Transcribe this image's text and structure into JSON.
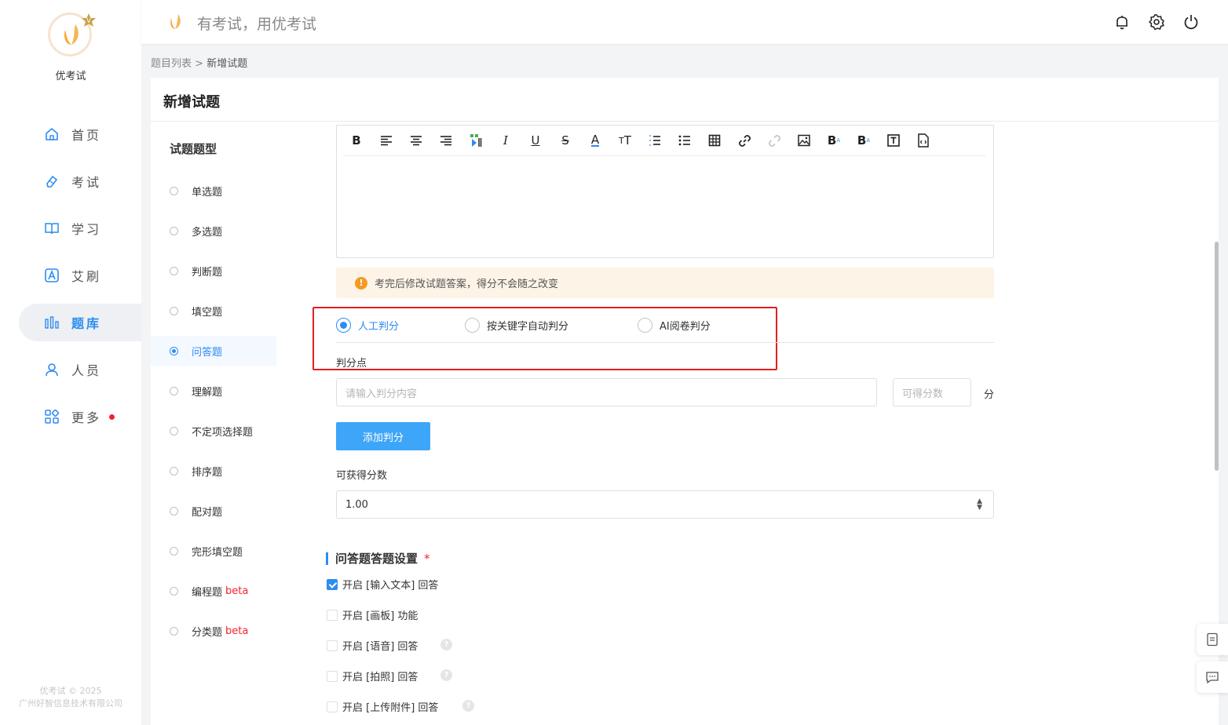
{
  "app": {
    "name": "优考试",
    "slogan": "有考试，用优考试",
    "copyright_line1": "优考试 © 2025",
    "copyright_line2": "广州好智信息技术有限公司"
  },
  "nav": [
    {
      "label": "首页",
      "icon": "home-icon"
    },
    {
      "label": "考试",
      "icon": "eraser-icon"
    },
    {
      "label": "学习",
      "icon": "book-icon"
    },
    {
      "label": "艾刷",
      "icon": "a-box-icon"
    },
    {
      "label": "题库",
      "icon": "bar-chart-icon",
      "active": true
    },
    {
      "label": "人员",
      "icon": "user-icon"
    },
    {
      "label": "更多",
      "icon": "apps-icon",
      "badge": "red-dot"
    }
  ],
  "header_icons": [
    "bell-icon",
    "gear-icon",
    "power-icon"
  ],
  "breadcrumb": {
    "parent": "题目列表",
    "separator": " > ",
    "current": "新增试题"
  },
  "page_title": "新增试题",
  "question_types": {
    "heading": "试题题型",
    "items": [
      {
        "label": "单选题"
      },
      {
        "label": "多选题"
      },
      {
        "label": "判断题"
      },
      {
        "label": "填空题"
      },
      {
        "label": "问答题",
        "selected": true
      },
      {
        "label": "理解题"
      },
      {
        "label": "不定项选择题"
      },
      {
        "label": "排序题"
      },
      {
        "label": "配对题"
      },
      {
        "label": "完形填空题"
      },
      {
        "label": "编程题",
        "beta": "beta"
      },
      {
        "label": "分类题",
        "beta": "beta"
      }
    ]
  },
  "editor_toolbar": [
    "bold-icon",
    "align-left-icon",
    "align-center-icon",
    "align-right-icon",
    "format-painter-icon",
    "italic-icon",
    "underline-icon",
    "strikethrough-icon",
    "font-color-icon",
    "font-size-icon",
    "ordered-list-icon",
    "unordered-list-icon",
    "table-icon",
    "link-icon",
    "unlink-icon",
    "image-icon",
    "superscript-icon",
    "subscript-icon",
    "textbox-icon",
    "source-code-icon"
  ],
  "warning": "考完后修改试题答案，得分不会随之改变",
  "scoring_mode": {
    "options": [
      {
        "label": "人工判分",
        "selected": true
      },
      {
        "label": "按关键字自动判分",
        "selected": false
      },
      {
        "label": "AI阅卷判分",
        "selected": false
      }
    ]
  },
  "scoring_points": {
    "label": "判分点",
    "content_placeholder": "请输入判分内容",
    "score_placeholder": "可得分数",
    "unit": "分",
    "add_button": "添加判分"
  },
  "total_score": {
    "label": "可获得分数",
    "value": "1.00"
  },
  "answer_settings": {
    "title": "问答题答题设置",
    "required_mark": "*",
    "options": [
      {
        "label": "开启 [输入文本] 回答",
        "checked": true,
        "help": false
      },
      {
        "label": "开启 [画板] 功能",
        "checked": false,
        "help": false
      },
      {
        "label": "开启 [语音] 回答",
        "checked": false,
        "help": true
      },
      {
        "label": "开启 [拍照] 回答",
        "checked": false,
        "help": true
      },
      {
        "label": "开启 [上传附件] 回答",
        "checked": false,
        "help": true
      }
    ],
    "help_glyph": "?"
  },
  "float_buttons": [
    "notes-icon",
    "chat-icon"
  ]
}
